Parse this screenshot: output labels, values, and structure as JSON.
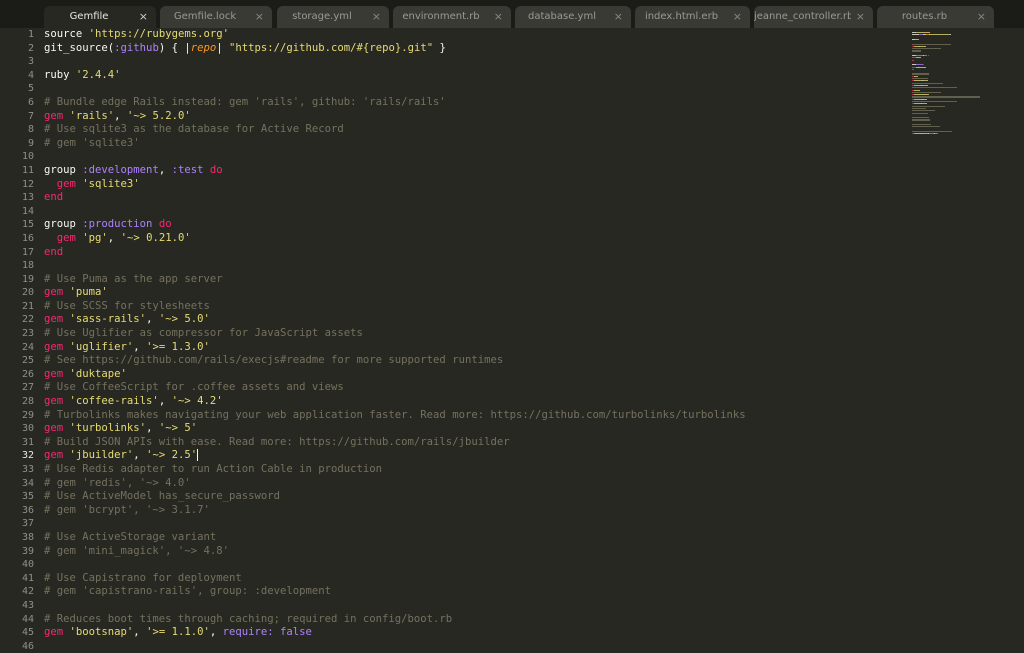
{
  "tabs": [
    {
      "label": "Gemfile",
      "active": true
    },
    {
      "label": "Gemfile.lock",
      "active": false
    },
    {
      "label": "storage.yml",
      "active": false
    },
    {
      "label": "environment.rb",
      "active": false
    },
    {
      "label": "database.yml",
      "active": false
    },
    {
      "label": "index.html.erb",
      "active": false
    },
    {
      "label": "jeanne_controller.rb",
      "active": false
    },
    {
      "label": "routes.rb",
      "active": false
    }
  ],
  "close_glyph": "×",
  "current_line": 32,
  "colors": {
    "background": "#272822",
    "text": "#f8f8f2",
    "string": "#e6db74",
    "keyword": "#f92672",
    "symbol": "#ae81ff",
    "comment": "#75715e",
    "variable": "#fd971f"
  },
  "code_lines": [
    [
      [
        "source ",
        "default"
      ],
      [
        "'https://rubygems.org'",
        "str"
      ]
    ],
    [
      [
        "git_source(",
        "default"
      ],
      [
        ":github",
        "sym"
      ],
      [
        ") { |",
        "default"
      ],
      [
        "repo",
        "var"
      ],
      [
        "| ",
        "default"
      ],
      [
        "\"https://github.com/#{repo}.git\"",
        "str"
      ],
      [
        " }",
        "default"
      ]
    ],
    [],
    [
      [
        "ruby ",
        "default"
      ],
      [
        "'2.4.4'",
        "str"
      ]
    ],
    [],
    [
      [
        "# Bundle edge Rails instead: gem 'rails', github: 'rails/rails'",
        "com"
      ]
    ],
    [
      [
        "gem ",
        "kw"
      ],
      [
        "'rails'",
        "str"
      ],
      [
        ", ",
        "default"
      ],
      [
        "'~> 5.2.0'",
        "str"
      ]
    ],
    [
      [
        "# Use sqlite3 as the database for Active Record",
        "com"
      ]
    ],
    [
      [
        "# gem 'sqlite3'",
        "com"
      ]
    ],
    [],
    [
      [
        "group ",
        "default"
      ],
      [
        ":development",
        "sym"
      ],
      [
        ", ",
        "default"
      ],
      [
        ":test",
        "sym"
      ],
      [
        " do",
        "kw"
      ]
    ],
    [
      [
        "  gem ",
        "kw"
      ],
      [
        "'sqlite3'",
        "str"
      ]
    ],
    [
      [
        "end",
        "kw"
      ]
    ],
    [],
    [
      [
        "group ",
        "default"
      ],
      [
        ":production",
        "sym"
      ],
      [
        " do",
        "kw"
      ]
    ],
    [
      [
        "  gem ",
        "kw"
      ],
      [
        "'pg'",
        "str"
      ],
      [
        ", ",
        "default"
      ],
      [
        "'~> 0.21.0'",
        "str"
      ]
    ],
    [
      [
        "end",
        "kw"
      ]
    ],
    [],
    [
      [
        "# Use Puma as the app server",
        "com"
      ]
    ],
    [
      [
        "gem ",
        "kw"
      ],
      [
        "'puma'",
        "str"
      ]
    ],
    [
      [
        "# Use SCSS for stylesheets",
        "com"
      ]
    ],
    [
      [
        "gem ",
        "kw"
      ],
      [
        "'sass-rails'",
        "str"
      ],
      [
        ", ",
        "default"
      ],
      [
        "'~> 5.0'",
        "str"
      ]
    ],
    [
      [
        "# Use Uglifier as compressor for JavaScript assets",
        "com"
      ]
    ],
    [
      [
        "gem ",
        "kw"
      ],
      [
        "'uglifier'",
        "str"
      ],
      [
        ", ",
        "default"
      ],
      [
        "'>= 1.3.0'",
        "str"
      ]
    ],
    [
      [
        "# See https://github.com/rails/execjs#readme for more supported runtimes",
        "com"
      ]
    ],
    [
      [
        "gem ",
        "kw"
      ],
      [
        "'duktape'",
        "str"
      ]
    ],
    [
      [
        "# Use CoffeeScript for .coffee assets and views",
        "com"
      ]
    ],
    [
      [
        "gem ",
        "kw"
      ],
      [
        "'coffee-rails'",
        "str"
      ],
      [
        ", ",
        "default"
      ],
      [
        "'~> 4.2'",
        "str"
      ]
    ],
    [
      [
        "# Turbolinks makes navigating your web application faster. Read more: https://github.com/turbolinks/turbolinks",
        "com"
      ]
    ],
    [
      [
        "gem ",
        "kw"
      ],
      [
        "'turbolinks'",
        "str"
      ],
      [
        ", ",
        "default"
      ],
      [
        "'~> 5'",
        "str"
      ]
    ],
    [
      [
        "# Build JSON APIs with ease. Read more: https://github.com/rails/jbuilder",
        "com"
      ]
    ],
    [
      [
        "gem ",
        "kw"
      ],
      [
        "'jbuilder'",
        "str"
      ],
      [
        ", ",
        "default"
      ],
      [
        "'~> 2.5'",
        "str"
      ]
    ],
    [
      [
        "# Use Redis adapter to run Action Cable in production",
        "com"
      ]
    ],
    [
      [
        "# gem 'redis', '~> 4.0'",
        "com"
      ]
    ],
    [
      [
        "# Use ActiveModel has_secure_password",
        "com"
      ]
    ],
    [
      [
        "# gem 'bcrypt', '~> 3.1.7'",
        "com"
      ]
    ],
    [],
    [
      [
        "# Use ActiveStorage variant",
        "com"
      ]
    ],
    [
      [
        "# gem 'mini_magick', '~> 4.8'",
        "com"
      ]
    ],
    [],
    [
      [
        "# Use Capistrano for deployment",
        "com"
      ]
    ],
    [
      [
        "# gem 'capistrano-rails', group: :development",
        "com"
      ]
    ],
    [],
    [
      [
        "# Reduces boot times through caching; required in config/boot.rb",
        "com"
      ]
    ],
    [
      [
        "gem ",
        "kw"
      ],
      [
        "'bootsnap'",
        "str"
      ],
      [
        ", ",
        "default"
      ],
      [
        "'>= 1.1.0'",
        "str"
      ],
      [
        ", ",
        "default"
      ],
      [
        "require:",
        "sym"
      ],
      [
        " ",
        "default"
      ],
      [
        "false",
        "sym"
      ]
    ],
    []
  ]
}
